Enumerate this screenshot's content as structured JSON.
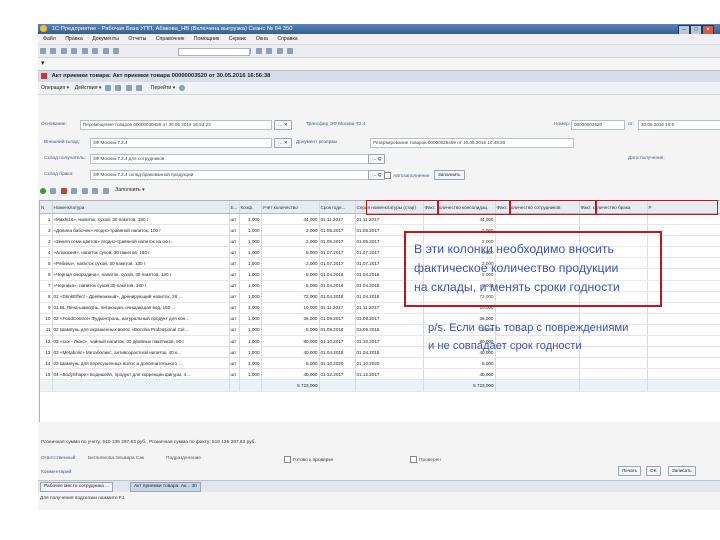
{
  "window": {
    "title": "1С:Предприятие - Рабочая База УПП, Абакова_НВ (Включена выгрузка) Сеанс № 64 350",
    "menu": [
      "Файл",
      "Правка",
      "Документы",
      "Отчеты",
      "Справочник",
      "Помощник",
      "Сервис",
      "Окна",
      "Справка"
    ]
  },
  "document": {
    "title": "Акт приемки товара: Акт приемки товара 00000003520 от 30.05.2016 16:56:38",
    "actions": [
      "Операция",
      "Действия",
      "Перейти"
    ],
    "basis_label": "Основание:",
    "basis_value": "Перемещение товаров 00000030428 от 30.05.2016 16:53:23",
    "transfer_link": "Трансфер ЭФ Москва Т2.4",
    "number_label": "Номер:",
    "number_value": "00000003520",
    "date_label": "от:",
    "date_value": "30.05.2016 16:5",
    "sender_label": "Внешний склад:",
    "sender_value": "ЗФ Москва Т.2.4",
    "docres_label": "Документ резервы",
    "docres_value": "Резервирование товаров 00000025459 от 10.05.2016 10:48:20",
    "warehouse_label": "Склад получатель:",
    "warehouse_value": "ЗФ Москва Т.2.4 для сотрудников",
    "receive_date_label": "Дата получения:",
    "defect_label": "Склад брака:",
    "defect_value": "ЗФ Москва Т.2.4 склад бракованной продукции",
    "autofill_label": "Автозаполнение",
    "fill_button": "Заполнить",
    "table_fill_button": "Заполнить"
  },
  "table": {
    "headers": [
      "N",
      "Номенклатура",
      "Е...",
      "Коэф.",
      "Учёт количество",
      "Срок годн...",
      "Серия номенклатуры (стар)",
      "Факт. количество консолидац.",
      "Факт. количество сотрудников",
      "Факт. количество брака",
      "Р"
    ],
    "rows": [
      [
        "1",
        "«Maxhi16», напиток, сухой, 30 пакетов, 180 г",
        "шт",
        "1,000",
        "44,000",
        "01.11.2017",
        "01.11.2017",
        "44,000",
        "",
        "",
        ""
      ],
      [
        "2",
        "«Долина бабочек» ягодно-травяной напиток, 100 г",
        "шт",
        "1,000",
        "2,000",
        "01.05.2017",
        "01.05.2017",
        "2,000",
        "",
        "",
        ""
      ],
      [
        "3",
        "«Земля семи цветов» ягодно-травяной напиток на осн...",
        "шт",
        "1,000",
        "2,000",
        "01.05.2017",
        "01.05.2017",
        "2,000",
        "",
        "",
        ""
      ],
      [
        "4",
        "«Алоказия», напиток сухой, 30 пакетов, 180 г",
        "шт",
        "1,000",
        "5,000",
        "01.07.2017",
        "01.07.2017",
        "5,000",
        "",
        "",
        ""
      ],
      [
        "5",
        "«Рябина», напиток сухой, 30 пакетов, 130 г",
        "шт",
        "1,000",
        "2,000",
        "01.07.2017",
        "01.07.2017",
        "2,000",
        "",
        "",
        ""
      ],
      [
        "6",
        "«Черная смородина», напиток, сухой, 30 пакетов, 130 г",
        "шт",
        "1,000",
        "5,000",
        "01.04.2018",
        "01.04.2018",
        "5,000",
        "",
        "",
        ""
      ],
      [
        "7",
        "«Черника», напиток сухой 30 пакетов, 180 г",
        "шт",
        "1,000",
        "5,000",
        "01.04.2018",
        "01.04.2018",
        "5,000",
        "",
        "",
        ""
      ],
      [
        "8",
        "01 «DrinkEffect - Дрейнажный», дренирующий напиток, 28 ...",
        "шт",
        "1,000",
        "72,000",
        "01.04.2018",
        "01.04.2018",
        "72,000",
        "",
        "",
        ""
      ],
      [
        "9",
        "01 BL Пена-шампунь, питающая, очищающая вод, 150 ...",
        "шт",
        "1,000",
        "10,000",
        "01.11.2017",
        "01.11.2017",
        "10,000",
        "",
        "",
        ""
      ],
      [
        "10",
        "02 «FoodControl» Фудконтроль, натуральный продукт для кон...",
        "шт",
        "1,000",
        "36,000",
        "01.09.2017",
        "01.09.2017",
        "36,000",
        "",
        "",
        ""
      ],
      [
        "11",
        "02 Шампунь для окрашенных волос «Bocoba Professional Col...",
        "шт",
        "1,000",
        "5,000",
        "01.09.2018",
        "01.09.2018",
        "5,000",
        "",
        "",
        ""
      ],
      [
        "12",
        "03 «Lux - Люкс», чайный напиток, 30 двойных пакетиков, 90 г",
        "шт",
        "1,000",
        "80,000",
        "01.10.2017",
        "01.10.2017",
        "80,000",
        "",
        "",
        ""
      ],
      [
        "13",
        "03 «Metabolic» Метаболикс, антивозрастной напиток, 40 к...",
        "шт",
        "1,000",
        "40,000",
        "01.04.2018",
        "01.04.2018",
        "40,000",
        "",
        "",
        ""
      ],
      [
        "14",
        "03 Шампунь для пересушенных волос и дополнительного ...",
        "шт",
        "1,000",
        "5,000",
        "01.10.2020",
        "01.10.2020",
        "5,000",
        "",
        "",
        ""
      ],
      [
        "15",
        "04 «BodyShape» Бодишейп, продукт для коррекции фигуры, 4...",
        "шт",
        "1,000",
        "40,000",
        "01.12.2017",
        "01.12.2017",
        "40,000",
        "",
        "",
        ""
      ]
    ],
    "total_qty": "5 723,000",
    "total_fact": "5 723,000"
  },
  "footer": {
    "sum_line": "Розничная сумма по учету: 510 135 297,63 руб., Розничная сумма по факту: 510 135 297,63 руб.",
    "responsible_label": "Ответственный:",
    "responsible_value": "Беглиянова Эльвира Сак",
    "received_label": "Подразделение",
    "ready_label": "Готово к проверке",
    "checked_label": "Проверен",
    "comment_label": "Комментарий:",
    "print_button": "Печать",
    "ok_button": "OK",
    "record_button": "Записать"
  },
  "taskbar": {
    "tabs": [
      "Рабочее место сотрудника ...",
      "Акт приемки товара: Ак... 30"
    ]
  },
  "statusbar": {
    "text": "Для получения подсказки нажмите F1"
  },
  "annotations": {
    "note1": [
      "В эти колонки необходимо вносить",
      "фактическое количество продукции",
      "на склады, и менять сроки годности"
    ],
    "note2": [
      "p/s. Если есть товар с повреждениями",
      "и не совпадает срок годности"
    ]
  },
  "colors": {
    "highlight": "#c01818",
    "note_text": "#3a52c8"
  }
}
